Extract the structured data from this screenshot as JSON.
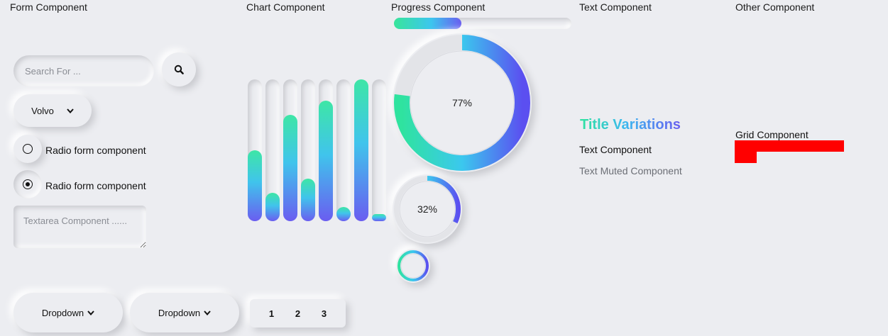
{
  "headers": {
    "form": "Form Component",
    "chart": "Chart Component",
    "progress": "Progress Component",
    "text": "Text Component",
    "other": "Other Component"
  },
  "form": {
    "search_placeholder": "Search For ...",
    "search_icon": "search-icon",
    "select_value": "Volvo",
    "radio1_label": "Radio form component",
    "radio1_checked": false,
    "radio2_label": "Radio form component",
    "radio2_checked": true,
    "textarea_placeholder": "Textarea Component ......",
    "dropdown1_label": "Dropdown",
    "dropdown2_label": "Dropdown",
    "pages": [
      "1",
      "2",
      "3"
    ]
  },
  "chart_data": {
    "type": "bar",
    "categories": [
      "",
      "",
      "",
      "",
      "",
      "",
      "",
      ""
    ],
    "values": [
      50,
      20,
      75,
      30,
      85,
      10,
      100,
      5
    ],
    "ylim": [
      0,
      100
    ],
    "colors": [
      "#3ee6a6",
      "#40c4ec",
      "#6a5df0"
    ]
  },
  "progress": {
    "bar_percent": 38,
    "ring_large_percent": 77,
    "ring_large_label": "77%",
    "ring_medium_percent": 32,
    "ring_medium_label": "32%",
    "ring_small_percent": 100,
    "gradient": [
      "#2fe39f",
      "#3bc8ee",
      "#5b4ff0"
    ]
  },
  "text": {
    "title": "Title Variations",
    "body": "Text Component",
    "muted": "Text Muted Component"
  },
  "other": {
    "grid_label": "Grid Component",
    "block_color": "#ff0000"
  }
}
